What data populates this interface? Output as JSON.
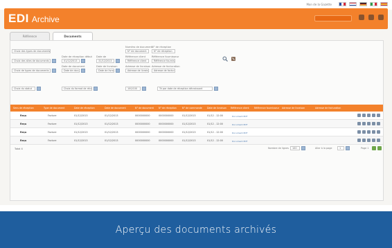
{
  "app": {
    "brand_main": "EDI",
    "brand_sub": "Archive"
  },
  "header": {
    "user": "Mon de la Gazette"
  },
  "tabs": [
    {
      "label": "Référence"
    },
    {
      "label": "Documents"
    }
  ],
  "filters": {
    "type_doc": "Choix des types de documents",
    "sites": "Choix des sites de documents",
    "clients": "Choix de types de documents",
    "date_from_label": "Date de réception début",
    "date_from": "01/12/2013",
    "date_to_label": "Date de",
    "date_to": "31/12/2013",
    "n_doc_label": "Numéro de document",
    "n_doc": "N° de document",
    "n_bl_label": "N° de réception",
    "n_bl": "N° de réception",
    "date_doc_label": "Date de document",
    "date_doc": "Date de document",
    "date_doc2_label": "Date de livraison",
    "date_doc2": "Date de livraison",
    "ref_label": "Référence client",
    "ref": "Référence client",
    "ref2_label": "Référence fournisseur",
    "ref2": "Référence fournisseur",
    "adr_label": "Adresse de livraison",
    "adr": "Adresse de livraison",
    "adr2_label": "Adresse de facturation",
    "adr2": "Adresse de facturation",
    "status": "Choix du statut",
    "format": "Choix du format de réception",
    "per_page": "100/100",
    "sort": "Tri par date de réception décroissant"
  },
  "table": {
    "headers": [
      "Sens de réception",
      "Type de document",
      "Date de réception",
      "Date de document",
      "N° de document",
      "N° de réception",
      "N° de commande",
      "Date de livraison",
      "Référence client",
      "Référence fournisseur",
      "Adresse de livraison",
      "Adresse de facturation"
    ],
    "rows": [
      {
        "sens": "Reçu",
        "type": "Facture",
        "date_r": "01/12/2013",
        "date_d": "01/12/2013",
        "no_doc": "0000000000",
        "no_rec": "0000000000",
        "no_cmd": "01/12/2013",
        "date_l": "01/12 - 12:00",
        "file": "Document PDF"
      },
      {
        "sens": "Reçu",
        "type": "Facture",
        "date_r": "01/12/2013",
        "date_d": "01/12/2013",
        "no_doc": "0000000000",
        "no_rec": "0000000000",
        "no_cmd": "01/12/2013",
        "date_l": "01/12 - 12:00",
        "file": "Document PDF"
      },
      {
        "sens": "Reçu",
        "type": "Facture",
        "date_r": "01/12/2013",
        "date_d": "01/12/2013",
        "no_doc": "0000000000",
        "no_rec": "0000000000",
        "no_cmd": "01/12/2013",
        "date_l": "01/12 - 12:00",
        "file": "Document PDF"
      },
      {
        "sens": "Reçu",
        "type": "Facture",
        "date_r": "01/12/2013",
        "date_d": "01/12/2013",
        "no_doc": "0000000000",
        "no_rec": "0000000000",
        "no_cmd": "01/12/2013",
        "date_l": "01/12 - 12:00",
        "file": "Document PDF"
      }
    ]
  },
  "pager": {
    "total": "Total 4",
    "rows_label": "Nombre de lignes",
    "rows_value": "100",
    "page_label": "Aller à la page",
    "page_value": "1",
    "nav_label": "Page 1"
  },
  "caption": "Aperçu des documents archivés",
  "colors": {
    "orange": "#f3812b",
    "blue": "#1f5e9e"
  }
}
